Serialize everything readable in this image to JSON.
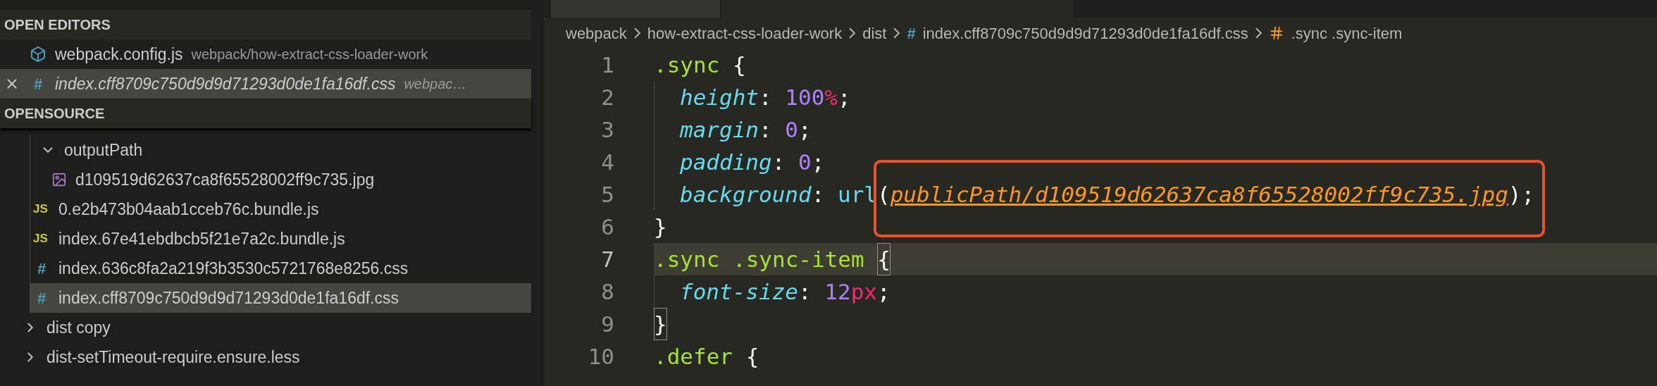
{
  "sidebar": {
    "open_editors": {
      "title": "OPEN EDITORS",
      "items": [
        {
          "kind": "config",
          "name": "webpack.config.js",
          "path": "webpack/how-extract-css-loader-work",
          "selected": false,
          "preview": false
        },
        {
          "kind": "css",
          "badge": "#",
          "name": "index.cff8709c750d9d9d71293d0de1fa16df.css",
          "path": "webpac…",
          "selected": true,
          "preview": true
        }
      ]
    },
    "explorer": {
      "title": "OPENSOURCE",
      "continued_children": [
        {
          "kind": "folder",
          "name": "outputPath",
          "expanded": true,
          "selected": false,
          "children": [
            {
              "kind": "image",
              "name": "d109519d62637ca8f65528002ff9c735.jpg",
              "selected": false
            }
          ]
        },
        {
          "kind": "js",
          "badge": "JS",
          "name": "0.e2b473b04aab1cceb76c.bundle.js",
          "selected": false
        },
        {
          "kind": "js",
          "badge": "JS",
          "name": "index.67e41ebdbcb5f21e7a2c.bundle.js",
          "selected": false
        },
        {
          "kind": "css",
          "badge": "#",
          "name": "index.636c8fa2a219f3b3530c5721768e8256.css",
          "selected": false
        },
        {
          "kind": "css",
          "badge": "#",
          "name": "index.cff8709c750d9d9d71293d0de1fa16df.css",
          "selected": true
        }
      ],
      "items": [
        {
          "kind": "folder",
          "name": "dist copy",
          "expanded": false,
          "selected": false
        },
        {
          "kind": "folder",
          "name": "dist-setTimeout-require.ensure.less",
          "expanded": false,
          "selected": false
        }
      ]
    }
  },
  "breadcrumb": [
    {
      "kind": "folder",
      "text": "webpack"
    },
    {
      "kind": "folder",
      "text": "how-extract-css-loader-work"
    },
    {
      "kind": "folder",
      "text": "dist"
    },
    {
      "kind": "css",
      "badge": "#",
      "text": "index.cff8709c750d9d9d71293d0de1fa16df.css"
    },
    {
      "kind": "symbol",
      "text": ".sync .sync-item"
    }
  ],
  "editor": {
    "lines": [
      {
        "number": "1",
        "indented": false,
        "highlighted": false,
        "tokens": [
          {
            "kind": "selector",
            "text": ".sync"
          },
          {
            "kind": "punct",
            "text": " {"
          }
        ]
      },
      {
        "number": "2",
        "indented": true,
        "highlighted": false,
        "tokens": [
          {
            "kind": "property",
            "text": "height"
          },
          {
            "kind": "punct",
            "text": ": "
          },
          {
            "kind": "number",
            "text": "100"
          },
          {
            "kind": "unit",
            "text": "%"
          },
          {
            "kind": "punct",
            "text": ";"
          }
        ]
      },
      {
        "number": "3",
        "indented": true,
        "highlighted": false,
        "tokens": [
          {
            "kind": "property",
            "text": "margin"
          },
          {
            "kind": "punct",
            "text": ": "
          },
          {
            "kind": "number",
            "text": "0"
          },
          {
            "kind": "punct",
            "text": ";"
          }
        ]
      },
      {
        "number": "4",
        "indented": true,
        "highlighted": false,
        "tokens": [
          {
            "kind": "property",
            "text": "padding"
          },
          {
            "kind": "punct",
            "text": ": "
          },
          {
            "kind": "number",
            "text": "0"
          },
          {
            "kind": "punct",
            "text": ";"
          }
        ]
      },
      {
        "number": "5",
        "indented": true,
        "highlighted": false,
        "tokens": [
          {
            "kind": "property",
            "text": "background"
          },
          {
            "kind": "punct",
            "text": ": "
          },
          {
            "kind": "function",
            "text": "url"
          },
          {
            "kind": "punct",
            "text": "("
          },
          {
            "kind": "string",
            "text": "publicPath/d109519d62637ca8f65528002ff9c735.jpg",
            "annotated": true
          },
          {
            "kind": "punct",
            "text": ");"
          }
        ]
      },
      {
        "number": "6",
        "indented": false,
        "highlighted": false,
        "tokens": [
          {
            "kind": "punct",
            "text": "}"
          }
        ]
      },
      {
        "number": "7",
        "indented": false,
        "highlighted": true,
        "tokens": [
          {
            "kind": "selector",
            "text": ".sync .sync-item "
          },
          {
            "kind": "punct",
            "text": "{",
            "matched": true
          }
        ]
      },
      {
        "number": "8",
        "indented": true,
        "highlighted": false,
        "tokens": [
          {
            "kind": "property",
            "text": "font-size"
          },
          {
            "kind": "punct",
            "text": ": "
          },
          {
            "kind": "number",
            "text": "12"
          },
          {
            "kind": "unit",
            "text": "px"
          },
          {
            "kind": "punct",
            "text": ";"
          }
        ]
      },
      {
        "number": "9",
        "indented": false,
        "highlighted": false,
        "tokens": [
          {
            "kind": "punct",
            "text": "}",
            "matched": true
          }
        ]
      },
      {
        "number": "10",
        "indented": false,
        "highlighted": false,
        "tokens": [
          {
            "kind": "selector",
            "text": ".defer"
          },
          {
            "kind": "punct",
            "text": " {"
          }
        ]
      }
    ]
  }
}
